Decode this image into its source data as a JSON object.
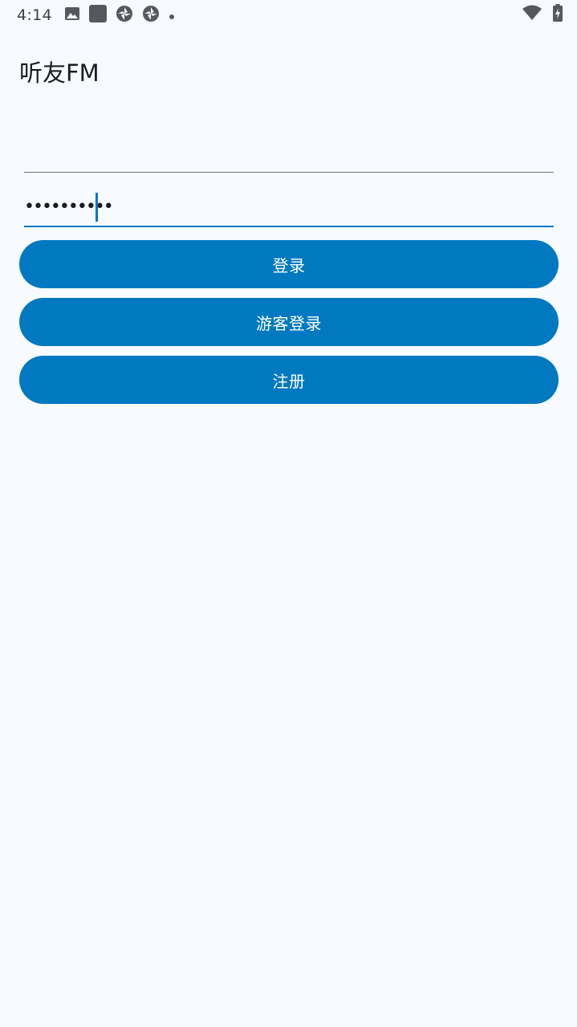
{
  "status_bar": {
    "time": "4:14",
    "left_icons": [
      "image-icon",
      "square-app-icon",
      "aperture-icon",
      "aperture-icon",
      "dot-icon"
    ],
    "right_icons": [
      "wifi-icon",
      "battery-charging-icon"
    ]
  },
  "app": {
    "title": "听友FM"
  },
  "form": {
    "username_value": "",
    "password_value": "••••••••••",
    "login_label": "登录",
    "guest_login_label": "游客登录",
    "register_label": "注册"
  },
  "colors": {
    "background": "#f7fbff",
    "accent": "#0079c1",
    "button_text": "#ffffff"
  }
}
